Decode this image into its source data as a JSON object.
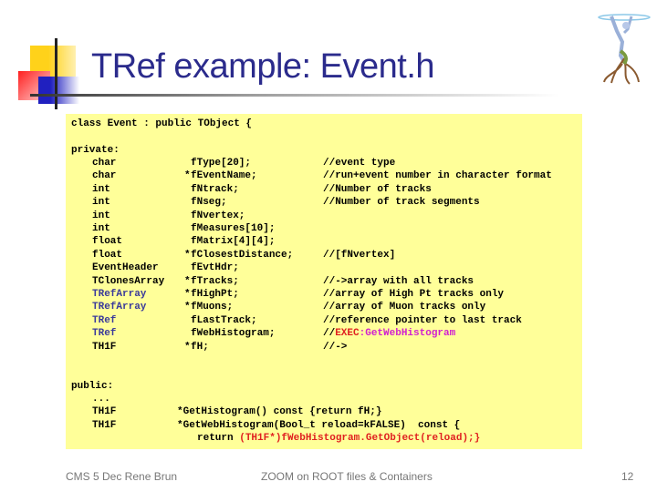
{
  "title": "TRef example: Event.h",
  "colors": {
    "title": "#2b2b8c",
    "code_bg": "#ffff99",
    "tref_type": "#3a3a9a",
    "exec": "#e02020",
    "getter": "#d020d0"
  },
  "code": {
    "class_decl": "class Event : public TObject {",
    "private_label": "private:",
    "members": [
      {
        "type": "char",
        "ptr": "",
        "name": "fType[20];",
        "comment": "//event type"
      },
      {
        "type": "char",
        "ptr": "*",
        "name": "fEventName;",
        "comment": "//run+event number in character format"
      },
      {
        "type": "int",
        "ptr": "",
        "name": "fNtrack;",
        "comment": "//Number of tracks"
      },
      {
        "type": "int",
        "ptr": "",
        "name": "fNseg;",
        "comment": "//Number of track segments"
      },
      {
        "type": "int",
        "ptr": "",
        "name": "fNvertex;",
        "comment": ""
      },
      {
        "type": "int",
        "ptr": "",
        "name": "fMeasures[10];",
        "comment": ""
      },
      {
        "type": "float",
        "ptr": "",
        "name": "fMatrix[4][4];",
        "comment": ""
      },
      {
        "type": "float",
        "ptr": "*",
        "name": "fClosestDistance;",
        "comment": "//[fNvertex]"
      },
      {
        "type": "EventHeader",
        "ptr": "",
        "name": "fEvtHdr;",
        "comment": ""
      },
      {
        "type": "TClonesArray",
        "ptr": "*",
        "name": "fTracks;",
        "comment": "//->array with all tracks"
      },
      {
        "type": "TRefArray",
        "ptr": "*",
        "name": "fHighPt;",
        "comment": "//array of High Pt tracks only",
        "highlight": true
      },
      {
        "type": "TRefArray",
        "ptr": "*",
        "name": "fMuons;",
        "comment": "//array of Muon tracks only",
        "highlight": true
      },
      {
        "type": "TRef",
        "ptr": "",
        "name": "fLastTrack;",
        "comment": "//reference pointer to last track",
        "highlight": true
      },
      {
        "type": "TRef",
        "ptr": "",
        "name": "fWebHistogram;",
        "comment": "//",
        "comment_exec": "EXEC",
        "comment_colon": ":",
        "comment_getter": "GetWebHistogram",
        "highlight": true
      },
      {
        "type": "TH1F",
        "ptr": "*",
        "name": "fH;",
        "comment": "//->"
      }
    ],
    "public_label": "public:",
    "ellipsis": "...",
    "method1_type": "TH1F",
    "method1": "*GetHistogram() const {return fH;}",
    "method2_type": "TH1F",
    "method2": "*GetWebHistogram(Bool_t reload=kFALSE)  const {",
    "method2_return": "return ",
    "method2_expr": "(TH1F*)fWebHistogram.GetObject(reload);}"
  },
  "footer": {
    "left": "CMS 5 Dec  Rene Brun",
    "center": "ZOOM on ROOT files & Containers",
    "page": "12"
  }
}
